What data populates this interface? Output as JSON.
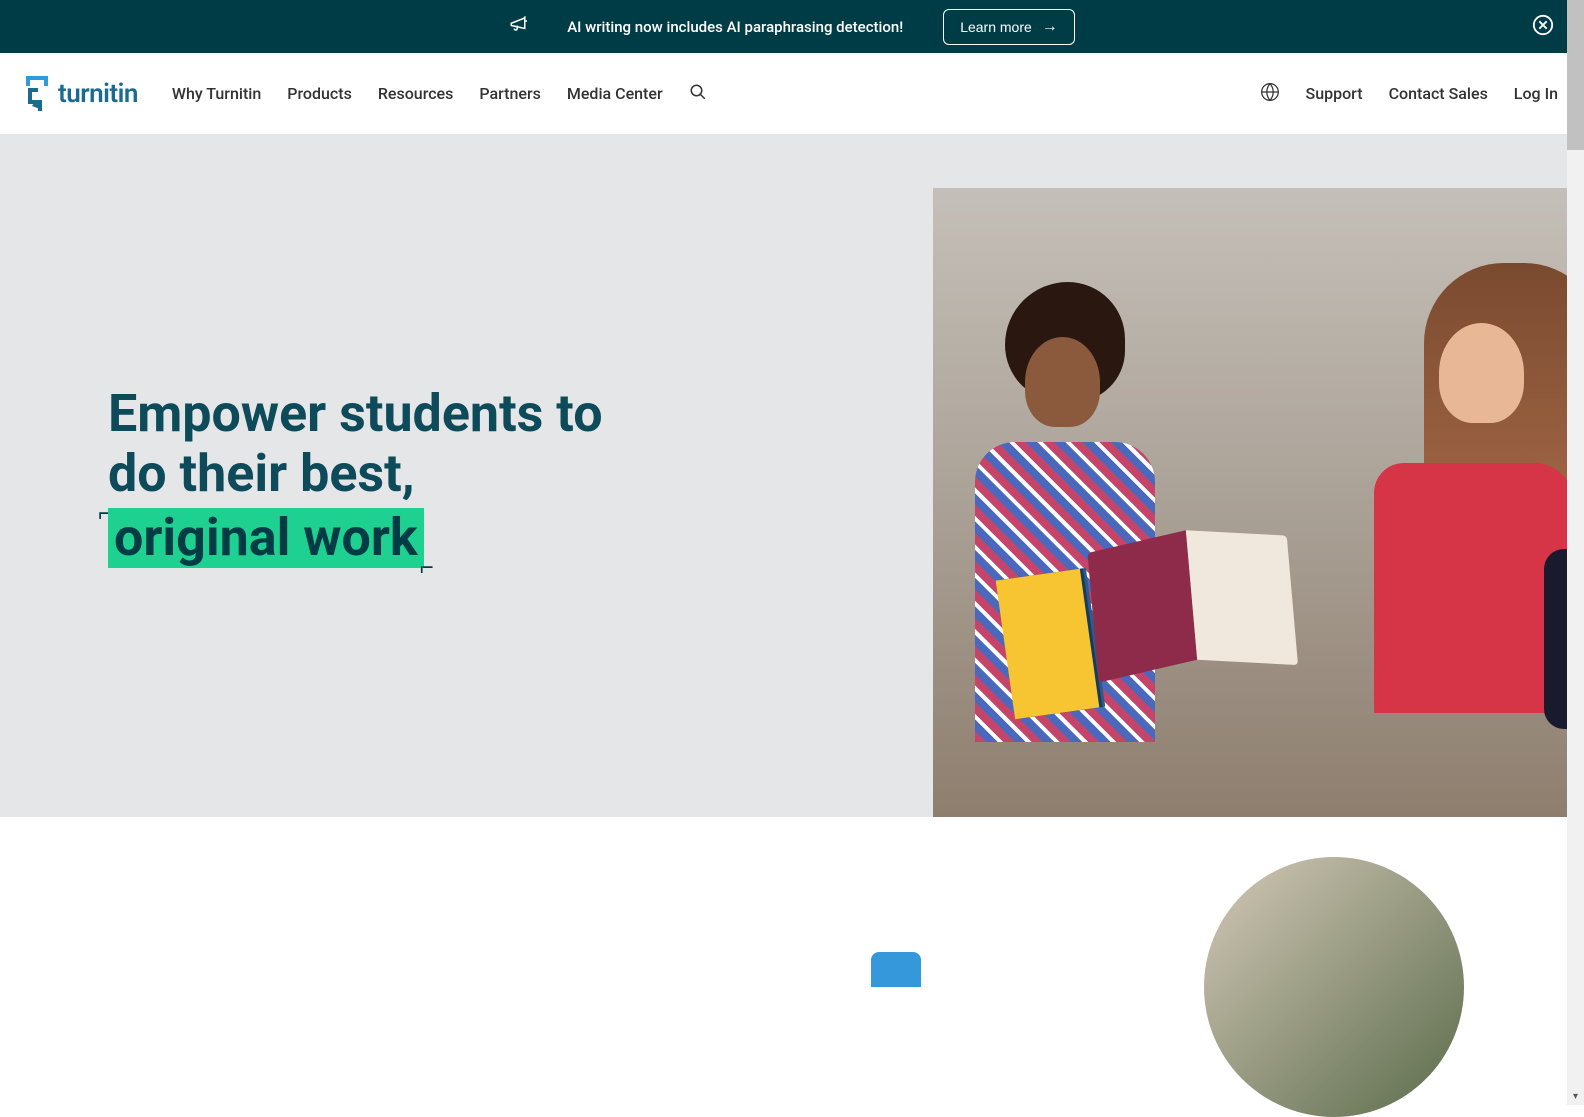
{
  "banner": {
    "text": "AI writing now includes AI paraphrasing detection!",
    "cta_label": "Learn more"
  },
  "logo": {
    "text": "turnitin"
  },
  "nav": {
    "left": [
      {
        "label": "Why Turnitin",
        "id": "why"
      },
      {
        "label": "Products",
        "id": "products"
      },
      {
        "label": "Resources",
        "id": "resources"
      },
      {
        "label": "Partners",
        "id": "partners"
      },
      {
        "label": "Media Center",
        "id": "media"
      }
    ],
    "right": [
      {
        "label": "Support",
        "id": "support"
      },
      {
        "label": "Contact Sales",
        "id": "contact"
      },
      {
        "label": "Log In",
        "id": "login"
      }
    ]
  },
  "hero": {
    "title_line1": "Empower students to",
    "title_line2": "do their best,",
    "highlight": "original work"
  }
}
